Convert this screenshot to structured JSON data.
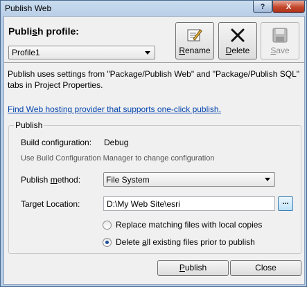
{
  "window": {
    "title": "Publish Web",
    "help_glyph": "?",
    "close_glyph": "X"
  },
  "profile": {
    "label": "Publish profile:",
    "selected": "Profile1"
  },
  "toolbar": {
    "rename_label": "Rename",
    "delete_label": "Delete",
    "save_label": "Save"
  },
  "description": "Publish uses settings from \"Package/Publish Web\" and \"Package/Publish SQL\" tabs in Project Properties.",
  "link_text": "Find Web hosting provider that supports one-click publish.",
  "publish_group": {
    "title": "Publish",
    "build_config_label": "Build configuration:",
    "build_config_value": "Debug",
    "hint": "Use Build Configuration Manager to change configuration",
    "method_label": "Publish method:",
    "method_value": "File System",
    "target_label": "Target Location:",
    "target_value": "D:\\My Web Site\\esri",
    "browse_label": "...",
    "radio_replace": "Replace matching files with local copies",
    "radio_delete": "Delete all existing files prior to publish",
    "selected_option": "delete"
  },
  "buttons": {
    "publish": "Publish",
    "close": "Close"
  },
  "icons": [
    "rename-icon",
    "delete-icon",
    "save-icon"
  ]
}
